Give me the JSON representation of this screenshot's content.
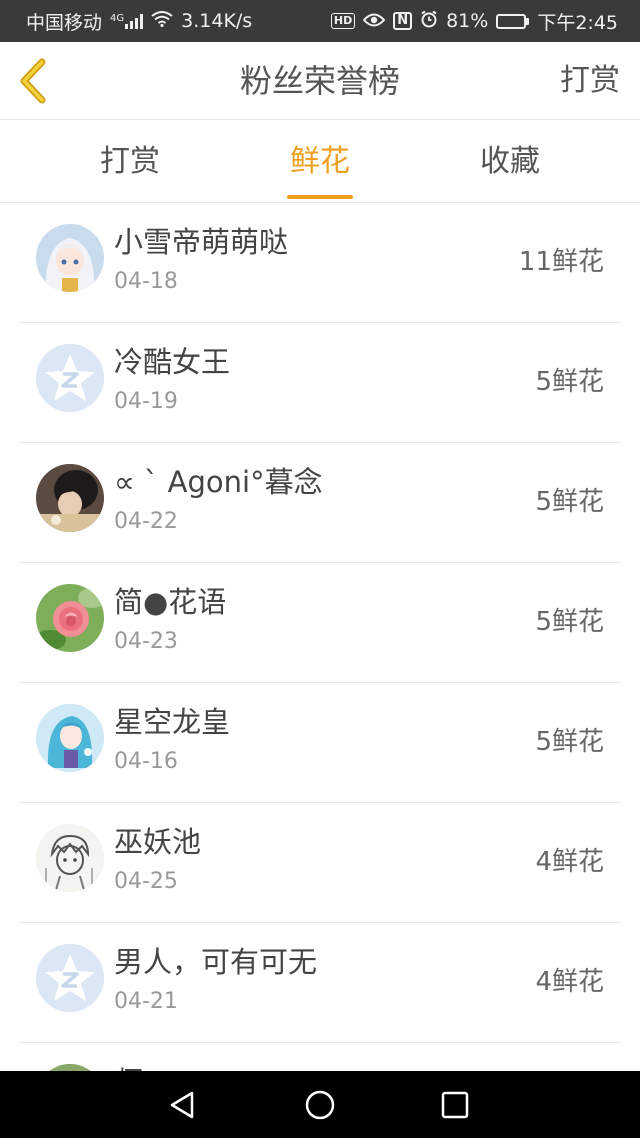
{
  "status_bar": {
    "carrier": "中国移动",
    "network": "4G",
    "speed": "3.14K/s",
    "battery": "81%",
    "battery_level": 0.81,
    "time": "下午2:45"
  },
  "header": {
    "title": "粉丝荣誉榜",
    "right_action": "打赏"
  },
  "tabs": [
    {
      "label": "打赏",
      "active": false
    },
    {
      "label": "鲜花",
      "active": true
    },
    {
      "label": "收藏",
      "active": false
    }
  ],
  "accent_color": "#f0a020",
  "fans": [
    {
      "name": "小雪帝萌萌哒",
      "date": "04-18",
      "count": "11鲜花",
      "avatar": "anime-girl-avatar"
    },
    {
      "name": "冷酷女王",
      "date": "04-19",
      "count": "5鲜花",
      "avatar": "default-star-avatar"
    },
    {
      "name": "∝ ˋ Agoni°暮念",
      "date": "04-22",
      "count": "5鲜花",
      "avatar": "photo-avatar"
    },
    {
      "name": "简●花语",
      "date": "04-23",
      "count": "5鲜花",
      "avatar": "rose-avatar"
    },
    {
      "name": "星空龙皇",
      "date": "04-16",
      "count": "5鲜花",
      "avatar": "anime-blue-avatar"
    },
    {
      "name": "巫妖池",
      "date": "04-25",
      "count": "4鲜花",
      "avatar": "sketch-avatar"
    },
    {
      "name": "男人，可有可无",
      "date": "04-21",
      "count": "4鲜花",
      "avatar": "default-star-avatar"
    },
    {
      "name": "师",
      "date": "",
      "count": "",
      "avatar": "partial-avatar"
    }
  ]
}
